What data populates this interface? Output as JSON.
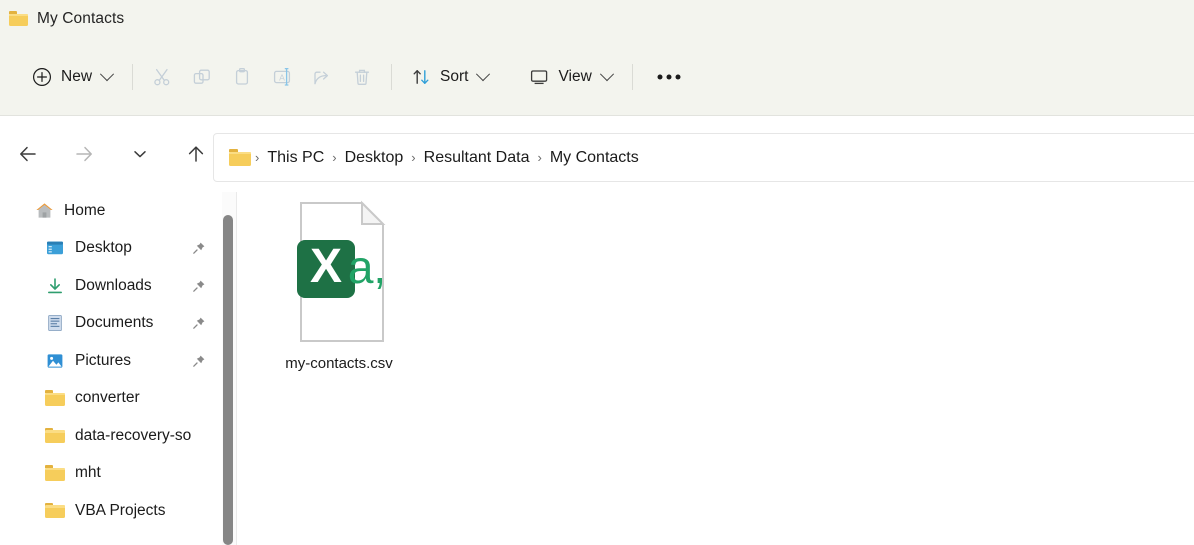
{
  "window": {
    "tab_title": "My Contacts",
    "tab_icon": "folder-icon"
  },
  "toolbar": {
    "new_label": "New",
    "new_icon": "plus-circle-icon",
    "cut_icon": "scissors-icon",
    "copy_icon": "copy-icon",
    "paste_icon": "paste-icon",
    "rename_icon": "rename-icon",
    "share_icon": "share-icon",
    "delete_icon": "trash-icon",
    "sort_label": "Sort",
    "sort_icon": "sort-arrows-icon",
    "view_label": "View",
    "view_icon": "monitor-icon",
    "more_label": "•••",
    "more_icon": "ellipsis-icon"
  },
  "navigation": {
    "back_icon": "arrow-left-icon",
    "forward_icon": "arrow-right-icon",
    "recent_icon": "chevron-down-icon",
    "up_icon": "arrow-up-icon"
  },
  "address_bar": {
    "folder_icon": "folder-icon",
    "separator": "›",
    "crumbs": [
      {
        "label": "This PC"
      },
      {
        "label": "Desktop"
      },
      {
        "label": "Resultant Data"
      },
      {
        "label": "My Contacts"
      }
    ]
  },
  "sidebar": {
    "items": [
      {
        "label": "Home",
        "icon": "home-icon",
        "level": "root",
        "pinned": false
      },
      {
        "label": "Desktop",
        "icon": "desktop-icon",
        "level": "child",
        "pinned": true
      },
      {
        "label": "Downloads",
        "icon": "download-icon",
        "level": "child",
        "pinned": true
      },
      {
        "label": "Documents",
        "icon": "document-icon",
        "level": "child",
        "pinned": true
      },
      {
        "label": "Pictures",
        "icon": "pictures-icon",
        "level": "child",
        "pinned": true
      },
      {
        "label": "converter",
        "icon": "folder-icon",
        "level": "child",
        "pinned": false
      },
      {
        "label": "data-recovery-so",
        "icon": "folder-icon",
        "level": "child",
        "pinned": false
      },
      {
        "label": "mht",
        "icon": "folder-icon",
        "level": "child",
        "pinned": false
      },
      {
        "label": "VBA Projects",
        "icon": "folder-icon",
        "level": "child",
        "pinned": false
      }
    ]
  },
  "content": {
    "files": [
      {
        "name": "my-contacts.csv",
        "icon": "csv-excel-icon"
      }
    ]
  },
  "colors": {
    "chrome_background": "#f3f4ee",
    "excel_green": "#1e7145",
    "excel_green_light": "#21a366",
    "folder_yellow": "#f6cd5b",
    "accent_blue": "#2f9fd8",
    "scrollbar_thumb": "#868686"
  }
}
